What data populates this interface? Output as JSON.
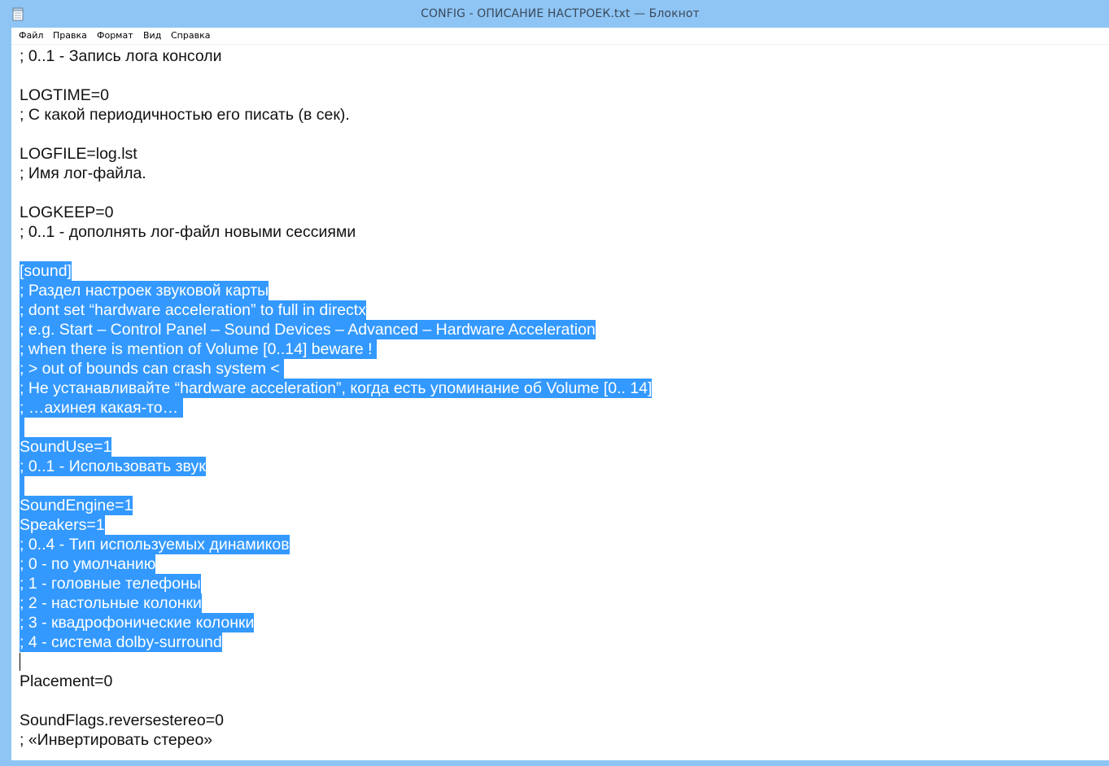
{
  "window": {
    "title": "CONFIG - ОПИСАНИЕ НАСТРОЕК.txt — Блокнот",
    "app_icon": "notepad-icon"
  },
  "menu": {
    "file": "Файл",
    "edit": "Правка",
    "format": "Формат",
    "view": "Вид",
    "help": "Справка"
  },
  "editor": {
    "lines": [
      {
        "text": "; 0..1 - Запись лога консоли",
        "selected": false
      },
      {
        "text": "",
        "selected": false
      },
      {
        "text": "LOGTIME=0",
        "selected": false
      },
      {
        "text": "; С какой периодичностью его писать (в сек).",
        "selected": false
      },
      {
        "text": "",
        "selected": false
      },
      {
        "text": "LOGFILE=log.lst",
        "selected": false
      },
      {
        "text": "; Имя лог-файла.",
        "selected": false
      },
      {
        "text": "",
        "selected": false
      },
      {
        "text": "LOGKEEP=0",
        "selected": false
      },
      {
        "text": "; 0..1 - дополнять лог-файл новыми сессиями",
        "selected": false
      },
      {
        "text": "",
        "selected": false
      },
      {
        "text": "[sound]",
        "selected": true
      },
      {
        "text": "; Раздел настроек звуковой карты",
        "selected": true
      },
      {
        "text": "; dont set “hardware acceleration” to full in directx",
        "selected": true
      },
      {
        "text": "; e.g. Start – Control Panel – Sound Devices – Advanced – Hardware Acceleration",
        "selected": true
      },
      {
        "text": "; when there is mention of Volume [0..14] beware ! ",
        "selected": true
      },
      {
        "text": "; > out of bounds can crash system < ",
        "selected": true
      },
      {
        "text": "; Не устанавливайте “hardware acceleration”, когда есть упоминание об Volume [0.. 14]",
        "selected": true
      },
      {
        "text": "; …ахинея какая-то… ",
        "selected": true
      },
      {
        "text": "",
        "selected": true
      },
      {
        "text": "SoundUse=1",
        "selected": true
      },
      {
        "text": "; 0..1 - Использовать звук",
        "selected": true
      },
      {
        "text": "",
        "selected": true
      },
      {
        "text": "SoundEngine=1",
        "selected": true
      },
      {
        "text": "Speakers=1",
        "selected": true
      },
      {
        "text": "; 0..4 - Тип используемых динамиков",
        "selected": true
      },
      {
        "text": "; 0 - по умолчанию",
        "selected": true
      },
      {
        "text": "; 1 - головные телефоны",
        "selected": true
      },
      {
        "text": "; 2 - настольные колонки",
        "selected": true
      },
      {
        "text": "; 3 - квадрофонические колонки",
        "selected": true
      },
      {
        "text": "; 4 - система dolby-surround",
        "selected": true
      },
      {
        "text": "",
        "selected": false
      },
      {
        "text": "Placement=0",
        "selected": false
      },
      {
        "text": "",
        "selected": false
      },
      {
        "text": "SoundFlags.reversestereo=0",
        "selected": false
      },
      {
        "text": "; «Инвертировать стерео»",
        "selected": false
      }
    ]
  },
  "colors": {
    "selection": "#3399ff",
    "frame": "#8fc5f4"
  }
}
